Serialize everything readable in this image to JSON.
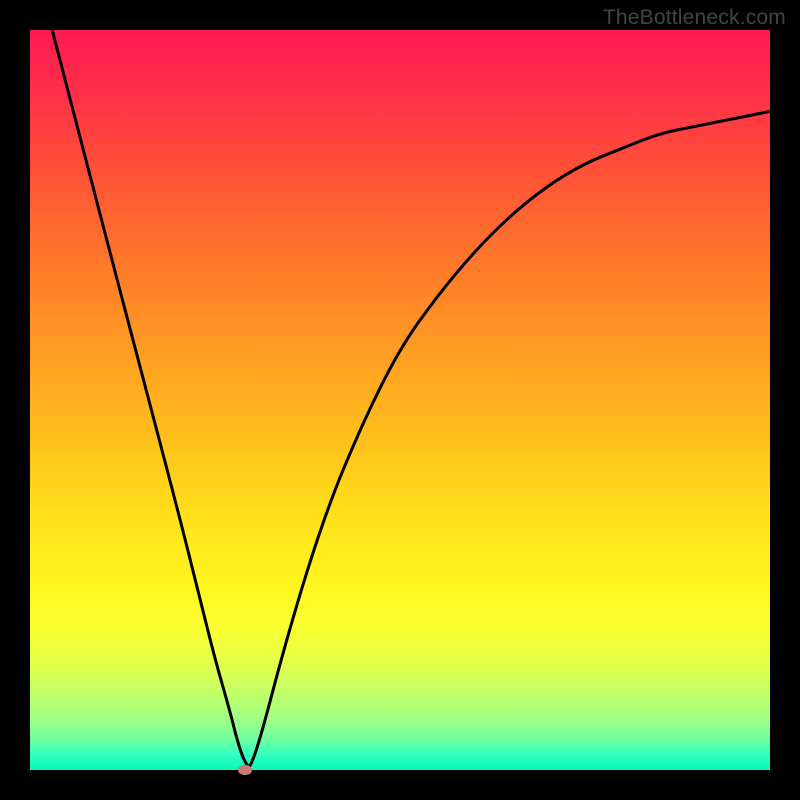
{
  "watermark": "TheBottleneck.com",
  "chart_data": {
    "type": "line",
    "title": "",
    "xlabel": "",
    "ylabel": "",
    "xlim": [
      0,
      100
    ],
    "ylim": [
      0,
      100
    ],
    "grid": false,
    "legend": false,
    "series": [
      {
        "name": "curve",
        "color": "#000000",
        "x": [
          3,
          10,
          15,
          20,
          23,
          25,
          27,
          28,
          29,
          30,
          35,
          40,
          45,
          50,
          55,
          60,
          65,
          70,
          75,
          80,
          85,
          90,
          95,
          100
        ],
        "y": [
          100,
          73,
          54,
          35,
          23,
          15,
          8,
          4,
          1,
          0,
          19,
          35,
          47,
          57,
          64,
          70,
          75,
          79,
          82,
          84,
          86,
          87,
          88,
          89
        ]
      }
    ],
    "marker": {
      "x": 29,
      "y": 0,
      "color": "#cc7a6f"
    },
    "background_gradient": {
      "top": "#ff1a52",
      "middle": "#ffe11a",
      "bottom": "#08f7bb"
    }
  }
}
